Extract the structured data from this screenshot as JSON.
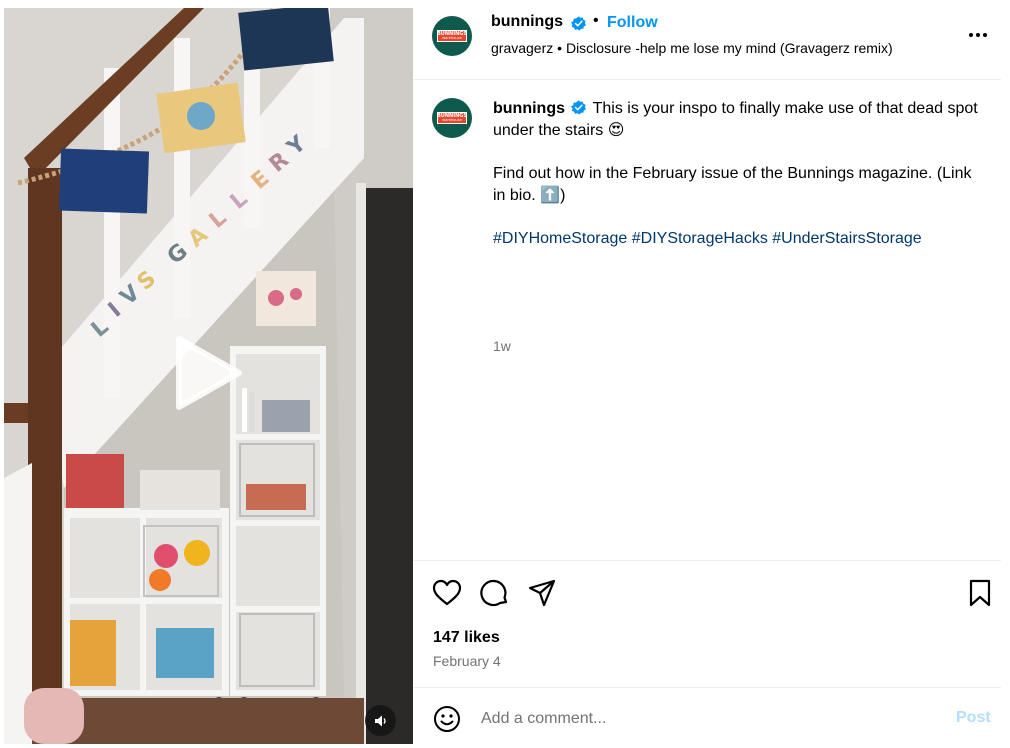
{
  "account": {
    "username": "bunnings",
    "verified": true,
    "follow_label": "Follow",
    "separator": "•",
    "logo_text_top": "BUNNINGS",
    "logo_text_bottom": "warehouse"
  },
  "audio": {
    "artist": "gravagerz",
    "separator": "•",
    "title": "Disclosure -help me lose my mind (Gravagerz remix)"
  },
  "media": {
    "type": "video",
    "wall_text_letters": [
      "L",
      "I",
      "V",
      "S",
      "G",
      "A",
      "L",
      "L",
      "E",
      "R",
      "Y"
    ]
  },
  "caption": {
    "line1": "This is your inspo to finally make use of that dead spot under the stairs",
    "emoji1": "😍",
    "line2": "Find out how in the February issue of the Bunnings magazine. (Link in bio.",
    "emoji2": "⬆️",
    "line2_end": ")",
    "hashtags": [
      "#DIYHomeStorage",
      "#DIYStorageHacks",
      "#UnderStairsStorage"
    ],
    "time_ago": "1w"
  },
  "engagement": {
    "likes": "147 likes",
    "date": "February 4"
  },
  "comment_box": {
    "placeholder": "Add a comment...",
    "post_label": "Post"
  },
  "colors": {
    "link": "#0095f6",
    "hashtag": "#00376b",
    "secondary_text": "#737373",
    "post_disabled": "#b2dffc",
    "brand_green": "#0e5a4c",
    "brand_red": "#e8452c"
  },
  "icons": [
    "play-icon",
    "sound-icon",
    "more-options-icon",
    "heart-icon",
    "comment-icon",
    "share-icon",
    "bookmark-icon",
    "emoji-icon",
    "verified-badge-icon"
  ]
}
